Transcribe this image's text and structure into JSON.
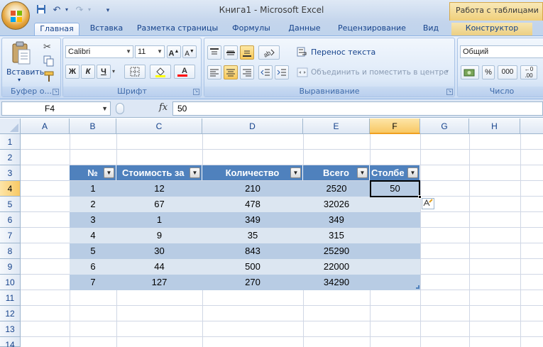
{
  "window": {
    "title": "Книга1 - Microsoft Excel",
    "context_tab_title": "Работа с таблицами"
  },
  "quick_access": {
    "icons": [
      "save-icon",
      "undo-icon",
      "redo-icon",
      "customize-icon"
    ]
  },
  "tabs": [
    "Главная",
    "Вставка",
    "Разметка страницы",
    "Формулы",
    "Данные",
    "Рецензирование",
    "Вид",
    "Конструктор"
  ],
  "active_tab": "Главная",
  "ribbon": {
    "clipboard": {
      "paste_label": "Вставить",
      "group_label": "Буфер о..."
    },
    "font": {
      "font_name": "Calibri",
      "font_size": "11",
      "grow_label": "A",
      "shrink_label": "A",
      "bold_label": "Ж",
      "italic_label": "К",
      "underline_label": "Ч",
      "font_color_label": "A",
      "group_label": "Шрифт"
    },
    "alignment": {
      "wrap_text_label": "Перенос текста",
      "merge_center_label": "Объединить и поместить в центре",
      "group_label": "Выравнивание"
    },
    "number": {
      "format": "Общий",
      "percent_label": "%",
      "thousands_label": "000",
      "group_label": "Число"
    }
  },
  "formula_bar": {
    "name_box": "F4",
    "fx_label": "fx",
    "value": "50"
  },
  "columns": [
    "A",
    "B",
    "C",
    "D",
    "E",
    "F",
    "G",
    "H"
  ],
  "selected_column": "F",
  "rows": [
    "1",
    "2",
    "3",
    "4",
    "5",
    "6",
    "7",
    "8",
    "9",
    "10",
    "11",
    "12",
    "13",
    "14"
  ],
  "selected_row": "4",
  "table": {
    "headers": [
      "№",
      "Стоимость за",
      "Количество",
      "Всего",
      "Столбе"
    ],
    "rows": [
      [
        "1",
        "12",
        "210",
        "2520",
        "50"
      ],
      [
        "2",
        "67",
        "478",
        "32026",
        ""
      ],
      [
        "3",
        "1",
        "349",
        "349",
        ""
      ],
      [
        "4",
        "9",
        "35",
        "315",
        ""
      ],
      [
        "5",
        "30",
        "843",
        "25290",
        ""
      ],
      [
        "6",
        "44",
        "500",
        "22000",
        ""
      ],
      [
        "7",
        "127",
        "270",
        "34290",
        ""
      ]
    ]
  },
  "colors": {
    "table_header": "#4f81bd",
    "band_dark": "#b8cce4",
    "band_light": "#dce6f1",
    "selection": "#f8c864"
  }
}
